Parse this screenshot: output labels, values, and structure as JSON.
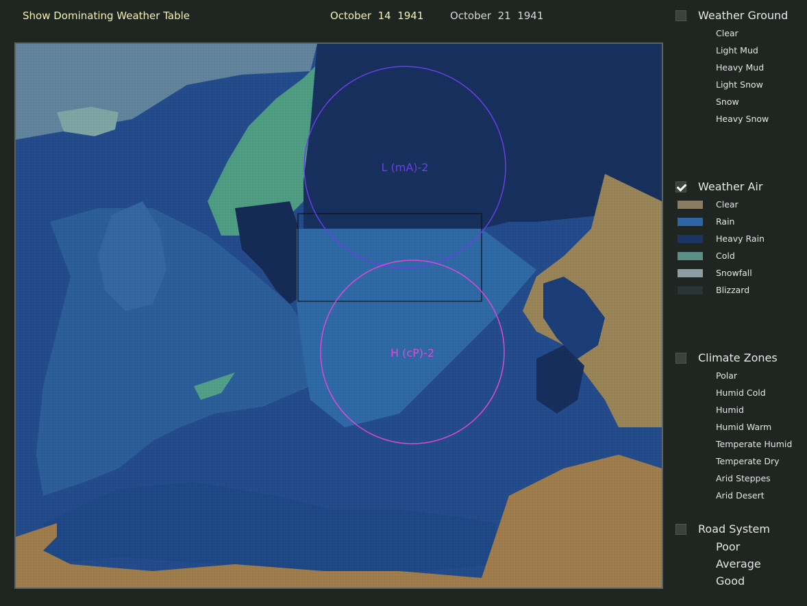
{
  "header": {
    "show_table_link": "Show Dominating Weather Table",
    "current_date": "October  14  1941",
    "next_date": "October  21  1941"
  },
  "map": {
    "fronts": [
      {
        "label": "L (mA)-2",
        "color": "#6a3fe8"
      },
      {
        "label": "H (cP)-2",
        "color": "#e048d8"
      }
    ],
    "colors": {
      "land_arid": "#a58a58",
      "land_arid_dark": "#8d7a52",
      "rain": "#2a5a9a",
      "heavy_rain": "#1a3466",
      "cold": "#4f9e8a",
      "snowfall": "#8aa4ac",
      "clear_light": "#3f7fb0"
    }
  },
  "panel": {
    "weather_ground": {
      "title": "Weather Ground",
      "checked": false,
      "items": [
        "Clear",
        "Light Mud",
        "Heavy Mud",
        "Light Snow",
        "Snow",
        "Heavy Snow"
      ]
    },
    "weather_air": {
      "title": "Weather Air",
      "checked": true,
      "items": [
        {
          "label": "Clear",
          "color": "#8a7b62"
        },
        {
          "label": "Rain",
          "color": "#2d66a6"
        },
        {
          "label": "Heavy Rain",
          "color": "#1c3463"
        },
        {
          "label": "Cold",
          "color": "#5a8f86"
        },
        {
          "label": "Snowfall",
          "color": "#8c9ea4"
        },
        {
          "label": "Blizzard",
          "color": "#2a3436"
        }
      ]
    },
    "climate_zones": {
      "title": "Climate Zones",
      "checked": false,
      "items": [
        "Polar",
        "Humid Cold",
        "Humid",
        "Humid Warm",
        "Temperate Humid",
        "Temperate Dry",
        "Arid Steppes",
        "Arid Desert"
      ]
    },
    "road_system": {
      "title": "Road System",
      "checked": false,
      "items": [
        "Poor",
        "Average",
        "Good"
      ]
    }
  }
}
